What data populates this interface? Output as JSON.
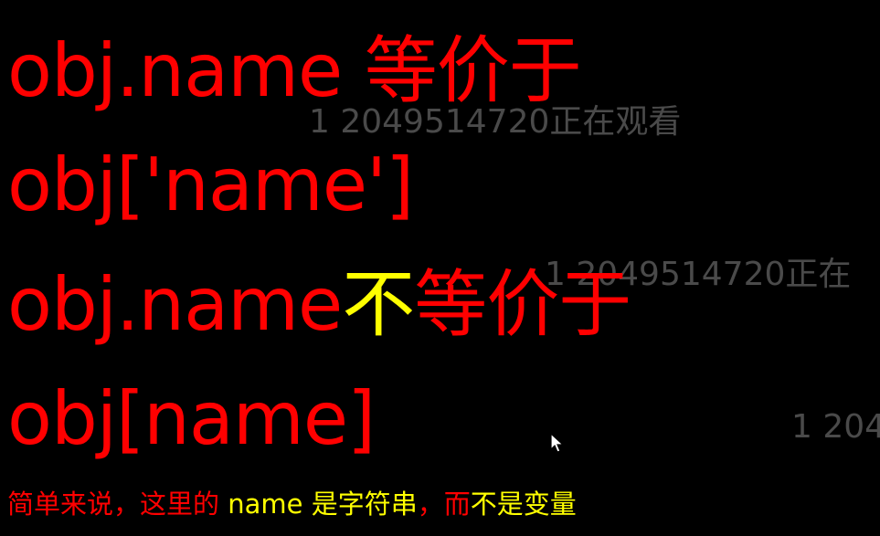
{
  "lines": [
    {
      "code": "obj.name",
      "text": "等价于"
    },
    {
      "code": "obj['name']"
    },
    {
      "code": "obj.name",
      "highlight": "不",
      "text": "等价于"
    },
    {
      "code": "obj[name]"
    }
  ],
  "caption": {
    "part1": "简单来说，这里的",
    "part2": " name 是字符串",
    "part3": "，",
    "part4": "而",
    "part5": "不是变量"
  },
  "watermarks": [
    "1 2049514720正在观看",
    "1 2049514720正在",
    "1 204"
  ],
  "colors": {
    "red": "#ff0000",
    "yellow": "#ffff00",
    "background": "#000000",
    "watermark": "#4a4a4a"
  }
}
